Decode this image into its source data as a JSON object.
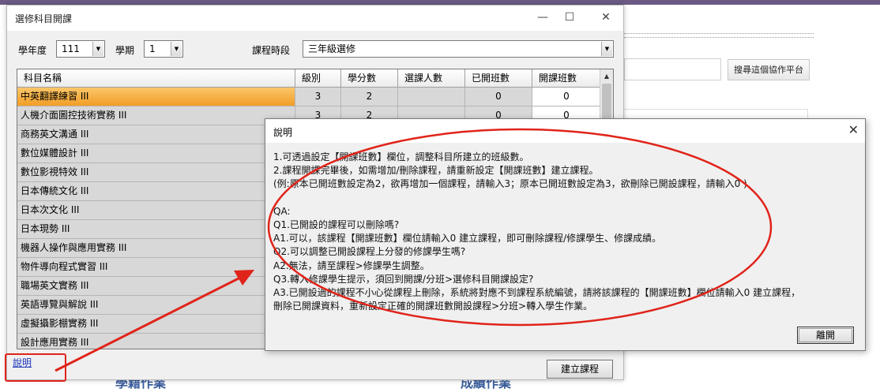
{
  "background": {
    "search_button": "搜尋這個協作平台",
    "link_left": "學籍作業",
    "link_right": "成績作業"
  },
  "window": {
    "title": "選修科目開課",
    "controls": {
      "minimize": "—",
      "maximize": "☐",
      "close": "✕"
    },
    "filters": {
      "year_label": "學年度",
      "year_value": "111",
      "term_label": "學期",
      "term_value": "1",
      "period_label": "課程時段",
      "period_value": "三年級選修"
    },
    "grid": {
      "columns": [
        "科目名稱",
        "級別",
        "學分數",
        "選課人數",
        "已開班數",
        "開課班數"
      ],
      "rows": [
        {
          "name": "中英翻譯練習 III",
          "level": "3",
          "credits": "2",
          "enrolled": "",
          "opened": "0",
          "open_count": "0"
        },
        {
          "name": "人機介面圖控技術實務 III",
          "level": "3",
          "credits": "2",
          "enrolled": "",
          "opened": "0",
          "open_count": "0"
        },
        {
          "name": "商務英文溝通 III"
        },
        {
          "name": "數位媒體設計 III"
        },
        {
          "name": "數位影視特效 III"
        },
        {
          "name": "日本傳統文化 III"
        },
        {
          "name": "日本次文化 III"
        },
        {
          "name": "日本現勢 III"
        },
        {
          "name": "機器人操作與應用實務 III"
        },
        {
          "name": "物件導向程式實習 III"
        },
        {
          "name": "職場英文實務 III"
        },
        {
          "name": "英語導覽與解說 III"
        },
        {
          "name": "虛擬攝影棚實務 III"
        },
        {
          "name": "設計應用實務 III"
        }
      ]
    },
    "help_link": "說明",
    "create_button": "建立課程"
  },
  "help_dialog": {
    "title": "說明",
    "close_icon": "✕",
    "lines": [
      "1.可透過設定【開課班數】欄位，調整科目所建立的班級數。",
      "2.課程開課完畢後，如需增加/刪除課程，請重新設定【開課班數】建立課程。",
      "(例:原本已開班數設定為2，欲再增加一個課程，請輸入3；原本已開班數設定為3，欲刪除已開設課程，請輸入0 )",
      "",
      "QA:",
      "Q1.已開設的課程可以刪除嗎?",
      "A1.可以，該課程【開課班數】欄位請輸入0 建立課程，即可刪除課程/修課學生、修課成績。",
      "Q2.可以調整已開設課程上分發的修課學生嗎?",
      "A2.無法，請至課程>修課學生調整。",
      "Q3.轉入修課學生提示，須回到開課/分班>選修科目開課設定?",
      "A3.已開設過的課程不小心從課程上刪除，系統將對應不到課程系統編號，請將該課程的【開課班數】欄位請輸入0 建立課程，",
      "刪除已開課資料，重新設定正確的開課班數開設課程>分班>轉入學生作業。"
    ],
    "close_button": "離開"
  },
  "colors": {
    "annotation": "#e0241a",
    "selected_row": "#f3a531",
    "link": "#1a35b8"
  }
}
